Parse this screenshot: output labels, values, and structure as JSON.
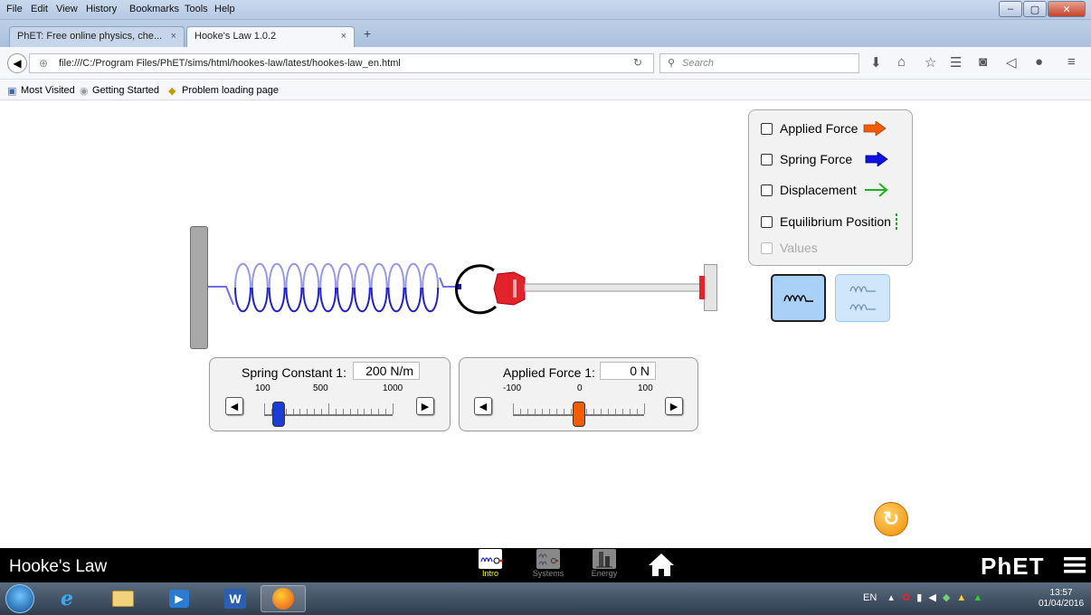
{
  "browser": {
    "menu": [
      "File",
      "Edit",
      "View",
      "History",
      "Bookmarks",
      "Tools",
      "Help"
    ],
    "tabs": [
      {
        "title": "PhET: Free online physics, che..."
      },
      {
        "title": "Hooke's Law 1.0.2"
      }
    ],
    "url": "file:///C:/Program Files/PhET/sims/html/hookes-law/latest/hookes-law_en.html",
    "search_placeholder": "Search",
    "bookmarks": [
      "Most Visited",
      "Getting Started",
      "Problem loading page"
    ]
  },
  "sim": {
    "spring_constant": {
      "label": "Spring Constant 1:",
      "value": "200 N/m",
      "ticks": [
        "100",
        "500",
        "1000"
      ],
      "level": 200,
      "range": [
        100,
        1000
      ]
    },
    "applied_force": {
      "label": "Applied Force 1:",
      "value": "0 N",
      "ticks": [
        "-100",
        "0",
        "100"
      ],
      "level": 0,
      "range": [
        -100,
        100
      ]
    },
    "checkboxes": [
      {
        "label": "Applied Force",
        "checked": false,
        "enabled": true
      },
      {
        "label": "Spring Force",
        "checked": false,
        "enabled": true
      },
      {
        "label": "Displacement",
        "checked": false,
        "enabled": true
      },
      {
        "label": "Equilibrium Position",
        "checked": false,
        "enabled": true
      },
      {
        "label": "Values",
        "checked": false,
        "enabled": false
      }
    ],
    "colors": {
      "applied_force": "#f25c05",
      "spring_force": "#1010e0",
      "displacement": "#1fb01f",
      "equilibrium": "#22aa22",
      "spring_coil": "#2020cc",
      "panel_bg": "#f2f2f2",
      "mode_selected": "#a9d1f7"
    }
  },
  "navbar": {
    "title": "Hooke's Law",
    "screens": [
      {
        "label": "Intro",
        "selected": true
      },
      {
        "label": "Systems",
        "selected": false
      },
      {
        "label": "Energy",
        "selected": false
      }
    ],
    "logo": "PhET"
  },
  "taskbar": {
    "lang": "EN",
    "time": "13:57",
    "date": "01/04/2016"
  }
}
